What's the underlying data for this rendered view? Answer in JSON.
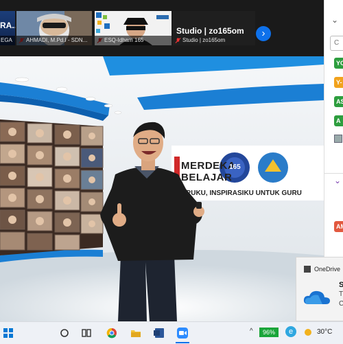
{
  "strip": {
    "partial_title": "RA...",
    "tiles": [
      {
        "name": "EGA"
      },
      {
        "name": "AHMADI, M.Pd.I - SDN..."
      },
      {
        "name": "ESQ-Idham 165"
      },
      {
        "name": "Studio | zo165om"
      }
    ],
    "studio_title": "Studio | zo165om",
    "next_label": "›"
  },
  "video": {
    "banner_line1": "MERDEKA",
    "banner_line2": "BELAJAR",
    "banner_line3": "GURUKU, INSPIRASIKU UNTUK GURU",
    "esq_logo_text": "165"
  },
  "panel": {
    "collapse_label": "⌄",
    "search_placeholder": "C",
    "chips": [
      {
        "label": "YO",
        "color": "#2e9e3f"
      },
      {
        "label": "Y-",
        "color": "#f1a21d"
      },
      {
        "label": "AS",
        "color": "#2e9e3f"
      },
      {
        "label": "A",
        "color": "#2e9e3f"
      }
    ],
    "red_chip": "AM",
    "caret": "⌄"
  },
  "toast": {
    "app": "OneDrive",
    "title_partial": "S",
    "line2": "T",
    "line3": "C"
  },
  "taskbar": {
    "battery": "96%",
    "temperature": "30°C",
    "edge_label": "e"
  },
  "colors": {
    "accent": "#0e71eb",
    "battery_green": "#1aa53a"
  }
}
